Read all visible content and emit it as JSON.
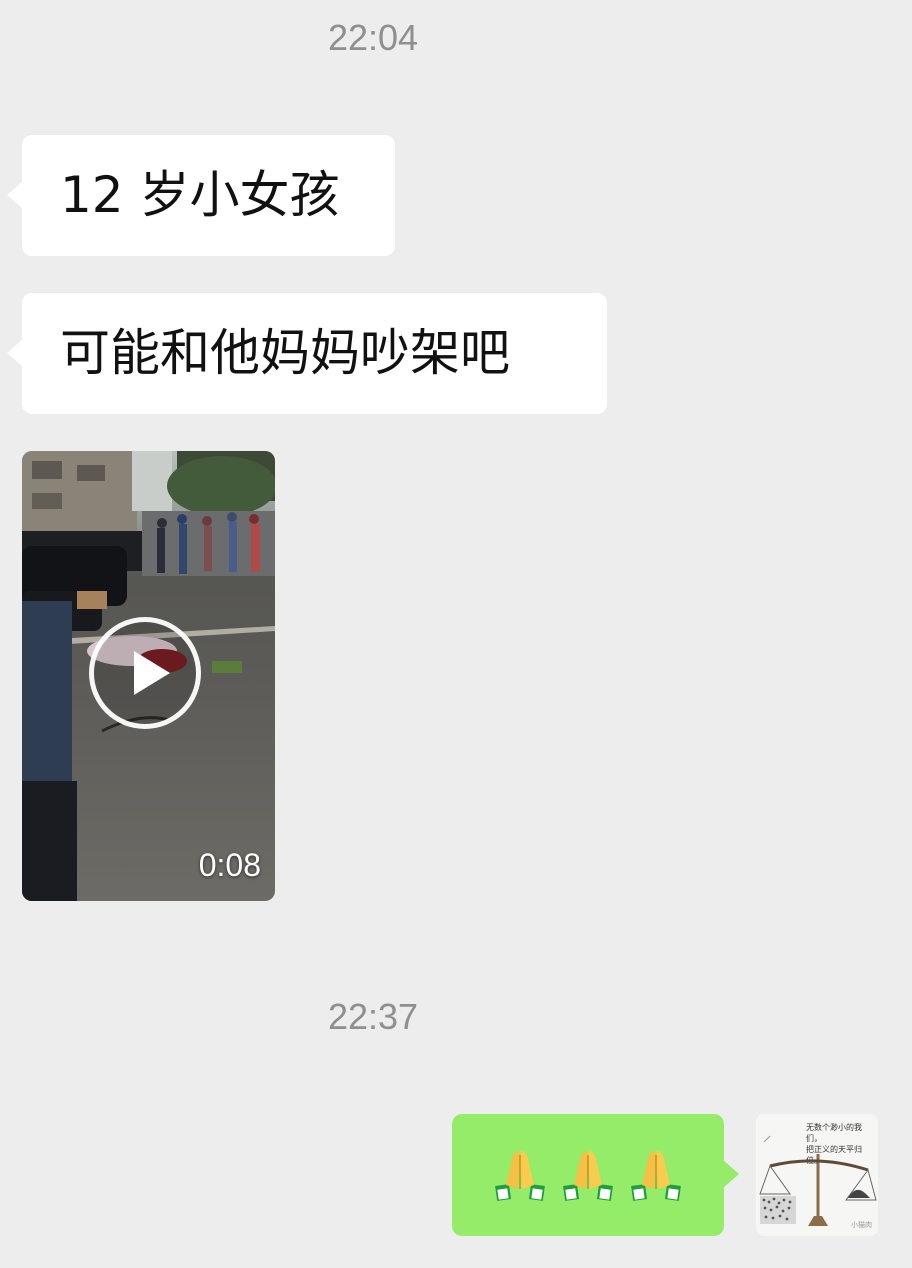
{
  "chat": {
    "timestamp_1": "22:04",
    "message_1": "12 岁小女孩",
    "message_2": "可能和他妈妈吵架吧",
    "video": {
      "duration": "0:08",
      "play_icon": "play-icon"
    },
    "timestamp_2": "22:37",
    "outgoing_message": {
      "emoji": [
        "folded-hands",
        "folded-hands",
        "folded-hands"
      ]
    },
    "own_avatar": {
      "caption_line_1": "无数个渺小的我们，",
      "caption_line_2": "把正义的天平归位。",
      "watermark": "小猫肉"
    }
  },
  "colors": {
    "background": "#ededed",
    "incoming_bubble": "#ffffff",
    "outgoing_bubble": "#95ec69",
    "timestamp_text": "#8f8f8f"
  }
}
